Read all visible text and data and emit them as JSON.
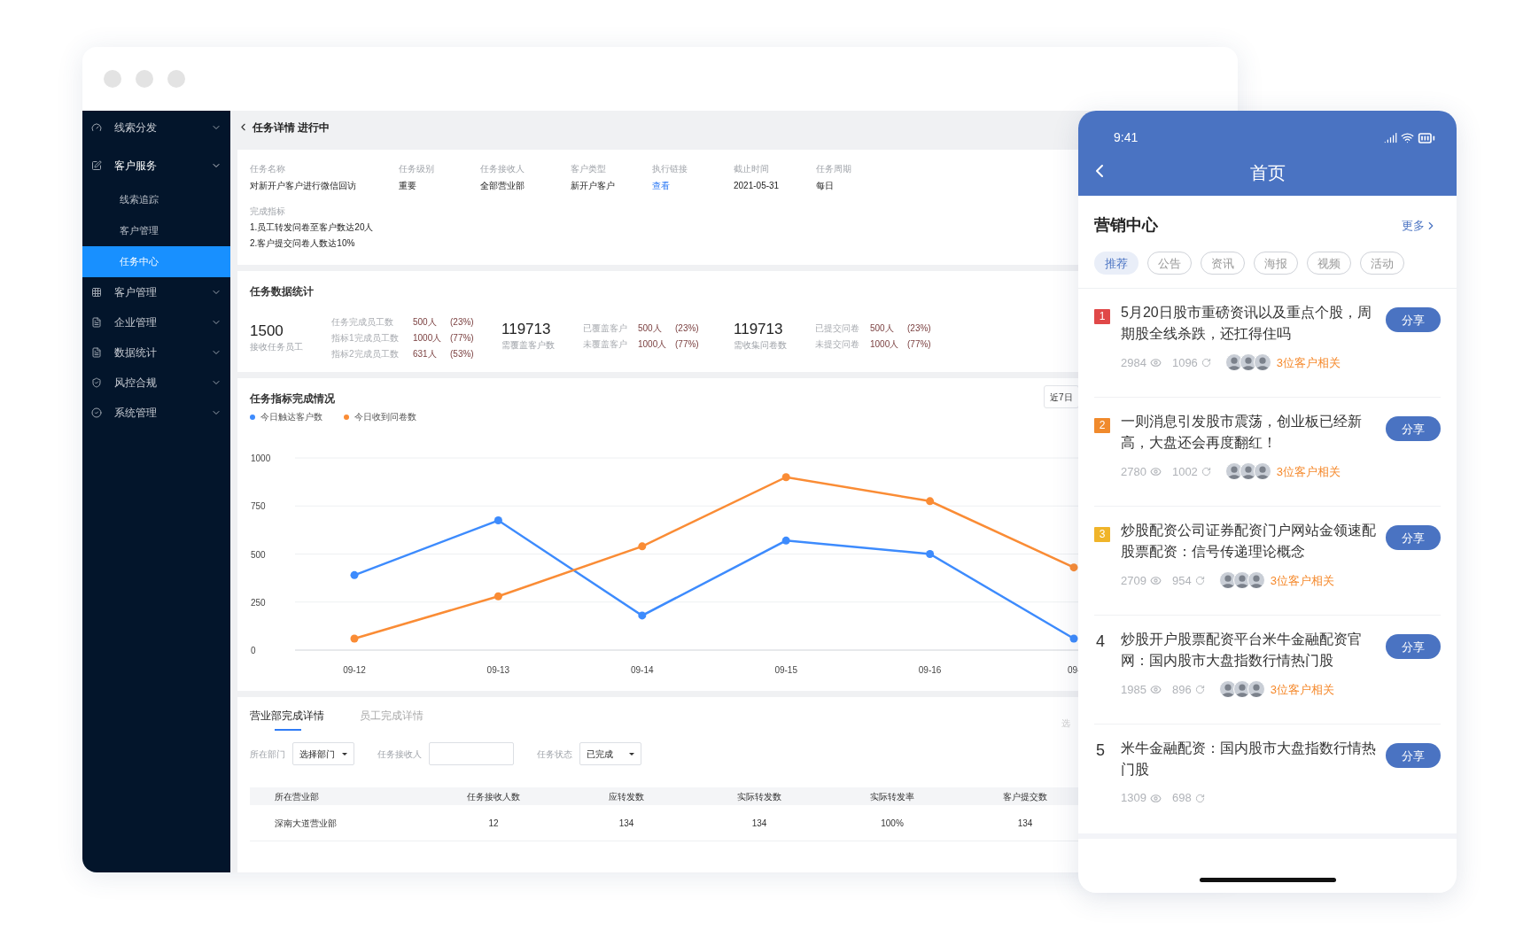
{
  "sidebar": {
    "items": [
      {
        "label": "线索分发",
        "expanded": false
      },
      {
        "label": "客户服务",
        "expanded": true,
        "children": [
          {
            "label": "线索追踪",
            "selected": false
          },
          {
            "label": "客户管理",
            "selected": false
          },
          {
            "label": "任务中心",
            "selected": true
          }
        ]
      },
      {
        "label": "客户管理",
        "expanded": false
      },
      {
        "label": "企业管理",
        "expanded": false
      },
      {
        "label": "数据统计",
        "expanded": false
      },
      {
        "label": "风控合规",
        "expanded": false
      },
      {
        "label": "系统管理",
        "expanded": false
      }
    ]
  },
  "page_header": {
    "title": "任务详情 进行中"
  },
  "task_info": {
    "fields": [
      {
        "label": "任务名称",
        "value": "对新开户客户进行微信回访",
        "kind": "text"
      },
      {
        "label": "任务级别",
        "value": "重要",
        "kind": "text"
      },
      {
        "label": "任务接收人",
        "value": "全部营业部",
        "kind": "text"
      },
      {
        "label": "客户类型",
        "value": "新开户客户",
        "kind": "text"
      },
      {
        "label": "执行链接",
        "value": "查看",
        "kind": "link"
      },
      {
        "label": "截止时间",
        "value": "2021-05-31",
        "kind": "text"
      },
      {
        "label": "任务周期",
        "value": "每日",
        "kind": "text"
      }
    ],
    "criteria": {
      "label": "完成指标",
      "lines": [
        "1.员工转发问卷至客户数达20人",
        "2.客户提交问卷人数达10%"
      ]
    }
  },
  "stats": {
    "title": "任务数据统计",
    "groups": [
      {
        "value": "1500",
        "caption": "接收任务员工",
        "rows": [
          {
            "label": "任务完成员工数",
            "count": "500人",
            "percent": "(23%)"
          },
          {
            "label": "指标1完成员工数",
            "count": "1000人",
            "percent": "(77%)"
          },
          {
            "label": "指标2完成员工数",
            "count": "631人",
            "percent": "(53%)"
          }
        ]
      },
      {
        "value": "119713",
        "caption": "需覆盖客户数",
        "rows": [
          {
            "label": "已覆盖客户",
            "count": "500人",
            "percent": "(23%)"
          },
          {
            "label": "未覆盖客户",
            "count": "1000人",
            "percent": "(77%)"
          }
        ]
      },
      {
        "value": "119713",
        "caption": "需收集问卷数",
        "rows": [
          {
            "label": "已提交问卷",
            "count": "500人",
            "percent": "(23%)"
          },
          {
            "label": "未提交问卷",
            "count": "1000人",
            "percent": "(77%)"
          }
        ]
      }
    ]
  },
  "chart_panel": {
    "title": "任务指标完成情况",
    "range_button": "近7日",
    "chart_data": {
      "type": "line",
      "categories": [
        "09-12",
        "09-13",
        "09-14",
        "09-15",
        "09-16",
        "09-"
      ],
      "ylim": [
        0,
        1000
      ],
      "yticks": [
        0,
        250,
        500,
        750,
        1000
      ],
      "grid": true,
      "series": [
        {
          "name": "今日触达客户数",
          "color": "#3d8bfd",
          "marker": true,
          "values": [
            390,
            675,
            180,
            570,
            500,
            60
          ]
        },
        {
          "name": "今日收到问卷数",
          "color": "#fa8c35",
          "marker": true,
          "values": [
            60,
            280,
            540,
            900,
            775,
            430
          ]
        }
      ]
    }
  },
  "details": {
    "tabs": [
      {
        "label": "营业部完成详情",
        "selected": true
      },
      {
        "label": "员工完成详情",
        "selected": false
      }
    ],
    "cut_text": "选",
    "filters": [
      {
        "label": "所在部门",
        "kind": "select",
        "value": "选择部门"
      },
      {
        "label": "任务接收人",
        "kind": "input"
      },
      {
        "label": "任务状态",
        "kind": "select",
        "value": "已完成"
      }
    ],
    "table": {
      "columns": [
        "所在营业部",
        "任务接收人数",
        "应转发数",
        "实际转发数",
        "实际转发率",
        "客户提交数"
      ],
      "rows": [
        [
          "深南大道营业部",
          "12",
          "134",
          "134",
          "100%",
          "134"
        ]
      ]
    }
  },
  "phone": {
    "status_time": "9:41",
    "nav_title": "首页",
    "section_title": "营销中心",
    "more_link": "更多",
    "chips": [
      {
        "label": "推荐",
        "selected": true
      },
      {
        "label": "公告",
        "selected": false
      },
      {
        "label": "资讯",
        "selected": false
      },
      {
        "label": "海报",
        "selected": false
      },
      {
        "label": "视频",
        "selected": false
      },
      {
        "label": "活动",
        "selected": false
      }
    ],
    "articles": [
      {
        "rank": "1",
        "kind": "badge",
        "color": "#e04848",
        "title": "5月20日股市重磅资讯以及重点个股，周期股全线杀跌，还扛得住吗",
        "views": "2984",
        "shares": "1096",
        "avatars": [
          {
            "kind": "avatar"
          },
          {
            "kind": "avatar"
          },
          {
            "kind": "avatar"
          }
        ],
        "related": "3位客户相关",
        "action": "分享"
      },
      {
        "rank": "2",
        "kind": "badge",
        "color": "#f08a2c",
        "title": "一则消息引发股市震荡，创业板已经新高，大盘还会再度翻红！",
        "views": "2780",
        "shares": "1002",
        "avatars": [
          {
            "kind": "avatar"
          },
          {
            "kind": "avatar"
          },
          {
            "kind": "avatar"
          }
        ],
        "related": "3位客户相关",
        "action": "分享"
      },
      {
        "rank": "3",
        "kind": "badge",
        "color": "#f0b429",
        "title": "炒股配资公司证券配资门户网站金领速配股票配资：信号传递理论概念",
        "views": "2709",
        "shares": "954",
        "avatars": [
          {
            "kind": "avatar"
          },
          {
            "kind": "avatar"
          },
          {
            "kind": "avatar"
          }
        ],
        "related": "3位客户相关",
        "action": "分享"
      },
      {
        "rank": "4",
        "kind": "plain",
        "title": "炒股开户股票配资平台米牛金融配资官网：国内股市大盘指数行情热门股",
        "views": "1985",
        "shares": "896",
        "avatars": [
          {
            "kind": "avatar"
          },
          {
            "kind": "avatar"
          },
          {
            "kind": "avatar"
          }
        ],
        "related": "3位客户相关",
        "action": "分享"
      },
      {
        "rank": "5",
        "kind": "plain",
        "title": "米牛金融配资：国内股市大盘指数行情热门股",
        "views": "1309",
        "shares": "698",
        "action": "分享"
      }
    ]
  }
}
